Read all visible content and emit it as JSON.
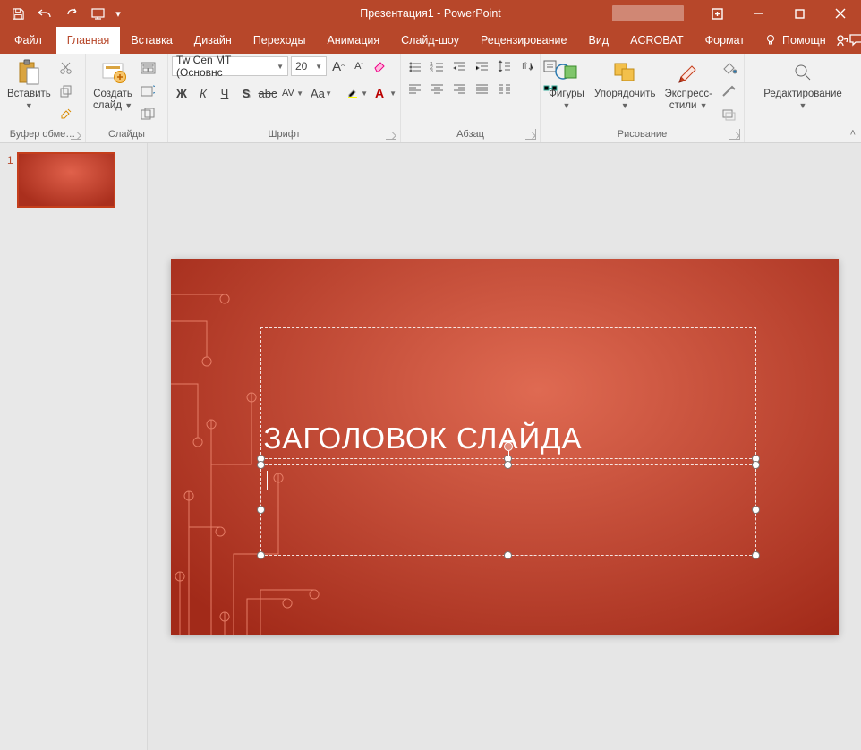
{
  "titlebar": {
    "document_title": "Презентация1 - PowerPoint"
  },
  "tabs": {
    "file": "Файл",
    "items": [
      "Главная",
      "Вставка",
      "Дизайн",
      "Переходы",
      "Анимация",
      "Слайд-шоу",
      "Рецензирование",
      "Вид",
      "ACROBAT",
      "Формат"
    ],
    "active_index": 0,
    "tell_me": "Помощн"
  },
  "ribbon": {
    "clipboard": {
      "label": "Буфер обме…",
      "paste": "Вставить"
    },
    "slides": {
      "label": "Слайды",
      "new_slide_line1": "Создать",
      "new_slide_line2": "слайд"
    },
    "font": {
      "label": "Шрифт",
      "font_name": "Tw Cen MT (Основнс",
      "font_size": "20",
      "bold": "Ж",
      "italic": "К",
      "underline": "Ч",
      "shadow": "S",
      "strike": "abc",
      "spacing": "AV",
      "case": "Aa"
    },
    "paragraph": {
      "label": "Абзац"
    },
    "drawing": {
      "label": "Рисование",
      "shapes": "Фигуры",
      "arrange": "Упорядочить",
      "quick_line1": "Экспресс-",
      "quick_line2": "стили"
    },
    "editing": {
      "label": "Редактирование"
    }
  },
  "thumbnail": {
    "number": "1"
  },
  "slide": {
    "title_placeholder": "ЗАГОЛОВОК СЛАЙДА"
  },
  "colors": {
    "accent": "#b7472a"
  }
}
